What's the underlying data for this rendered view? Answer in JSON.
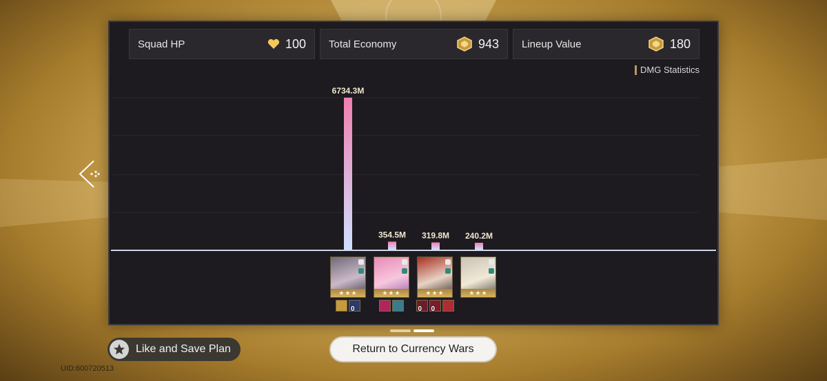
{
  "stats": {
    "squad_hp": {
      "label": "Squad HP",
      "value": "100"
    },
    "total_economy": {
      "label": "Total Economy",
      "value": "943"
    },
    "lineup_value": {
      "label": "Lineup Value",
      "value": "180"
    }
  },
  "dmg_statistics_title": "DMG Statistics",
  "chart_data": {
    "type": "bar",
    "title": "DMG Statistics",
    "unit": "M",
    "values": [
      6734.3,
      354.5,
      319.8,
      240.2
    ],
    "labels": [
      "6734.3M",
      "354.5M",
      "319.8M",
      "240.2M"
    ],
    "ylim": [
      0,
      6734.3
    ]
  },
  "characters": [
    {
      "name": "character-1",
      "colors": [
        "#6f6a78",
        "#cbb9c9",
        "#3b3846"
      ],
      "stars": "★★★",
      "items": [
        {
          "color": "#c99a3a",
          "count": ""
        },
        {
          "color": "#2b3c6e",
          "count": "0"
        }
      ]
    },
    {
      "name": "character-2",
      "colors": [
        "#e98ab6",
        "#f7c7dc",
        "#9a5fb0"
      ],
      "stars": "★★★",
      "items": [
        {
          "color": "#b3245e",
          "count": ""
        },
        {
          "color": "#3a7c8d",
          "count": ""
        }
      ]
    },
    {
      "name": "character-3",
      "colors": [
        "#a83022",
        "#e6d3c4",
        "#3c2a28"
      ],
      "stars": "★★★",
      "items": [
        {
          "color": "#6e1c2a",
          "count": "0"
        },
        {
          "color": "#7b1c2e",
          "count": "0"
        },
        {
          "color": "#b22a33",
          "count": ""
        }
      ]
    },
    {
      "name": "character-4",
      "colors": [
        "#c8c2b6",
        "#f1e8d6",
        "#4f4a45"
      ],
      "stars": "★★★",
      "items": []
    }
  ],
  "buttons": {
    "like_save": "Like and Save Plan",
    "return": "Return to Currency Wars"
  },
  "uid": "UID:600720513",
  "colors": {
    "bar_top": "#f07fb0",
    "bar_bottom": "#cfe0ff",
    "accent_gold": "#d9b25e"
  }
}
